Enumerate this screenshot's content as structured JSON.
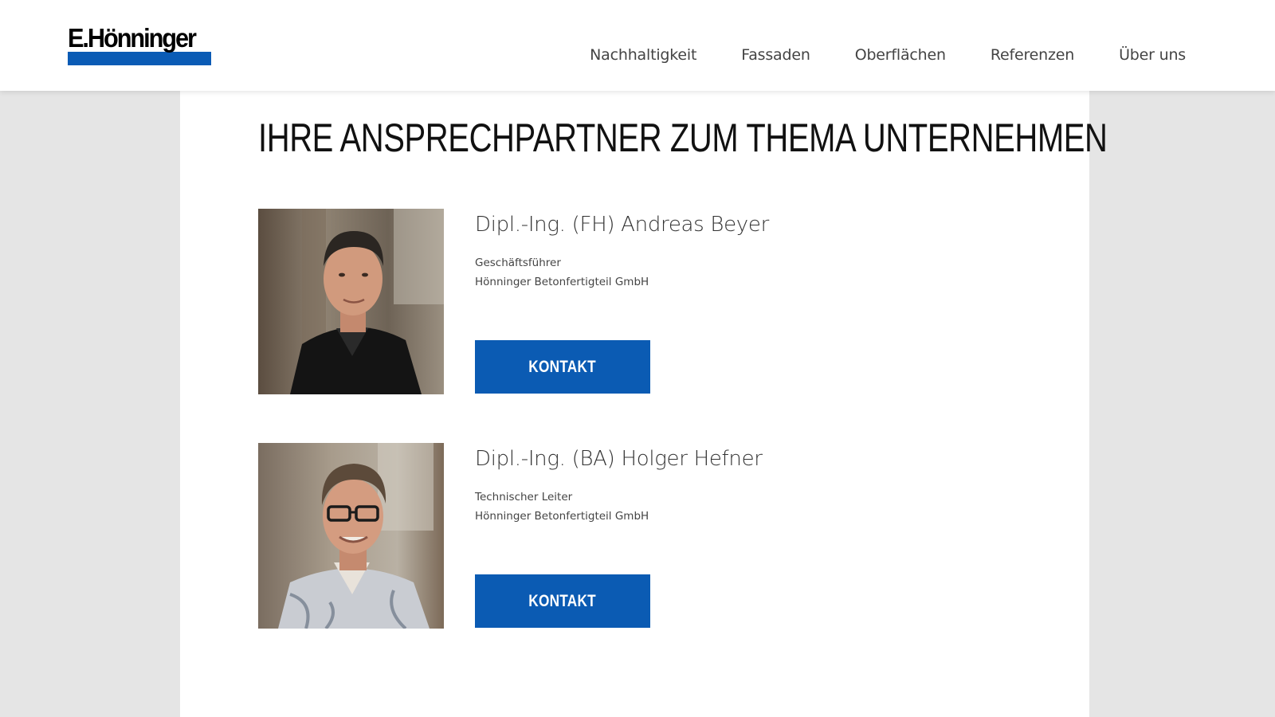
{
  "brand": {
    "name": "E.Hönninger",
    "accent_color": "#0a5bb5",
    "button_color": "#0b5bb3"
  },
  "nav": {
    "items": [
      {
        "label": "Nachhaltigkeit"
      },
      {
        "label": "Fassaden"
      },
      {
        "label": "Oberflächen"
      },
      {
        "label": "Referenzen"
      },
      {
        "label": "Über uns"
      }
    ]
  },
  "page": {
    "title": "IHRE ANSPRECHPARTNER ZUM THEMA UNTERNEHMEN"
  },
  "contacts": [
    {
      "name": "Dipl.-Ing. (FH) Andreas Beyer",
      "role": "Geschäftsführer",
      "company": "Hönninger Betonfertigteil GmbH",
      "button_label": "KONTAKT"
    },
    {
      "name": "Dipl.-Ing. (BA) Holger Hefner",
      "role": "Technischer Leiter",
      "company": "Hönninger Betonfertigteil GmbH",
      "button_label": "KONTAKT"
    }
  ]
}
